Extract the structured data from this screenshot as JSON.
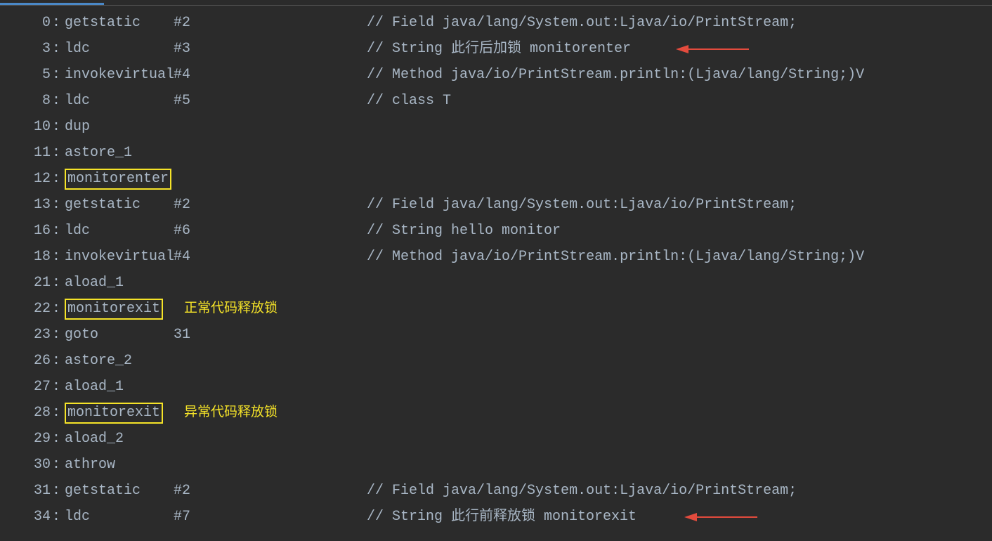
{
  "lines": [
    {
      "addr": "0",
      "instr": "getstatic",
      "arg": "#2",
      "comment": "// Field java/lang/System.out:Ljava/io/PrintStream;"
    },
    {
      "addr": "3",
      "instr": "ldc",
      "arg": "#3",
      "comment": "// String 此行后加锁 monitorenter",
      "arrow1": true
    },
    {
      "addr": "5",
      "instr": "invokevirtual",
      "arg": "#4",
      "comment": "// Method java/io/PrintStream.println:(Ljava/lang/String;)V"
    },
    {
      "addr": "8",
      "instr": "ldc",
      "arg": "#5",
      "comment": "// class T"
    },
    {
      "addr": "10",
      "instr": "dup",
      "arg": "",
      "comment": ""
    },
    {
      "addr": "11",
      "instr": "astore_1",
      "arg": "",
      "comment": ""
    },
    {
      "addr": "12",
      "instr": "monitorenter",
      "arg": "",
      "comment": "",
      "boxed": true
    },
    {
      "addr": "13",
      "instr": "getstatic",
      "arg": "#2",
      "comment": "// Field java/lang/System.out:Ljava/io/PrintStream;"
    },
    {
      "addr": "16",
      "instr": "ldc",
      "arg": "#6",
      "comment": "// String hello monitor"
    },
    {
      "addr": "18",
      "instr": "invokevirtual",
      "arg": "#4",
      "comment": "// Method java/io/PrintStream.println:(Ljava/lang/String;)V"
    },
    {
      "addr": "21",
      "instr": "aload_1",
      "arg": "",
      "comment": ""
    },
    {
      "addr": "22",
      "instr": "monitorexit",
      "arg": "",
      "comment": "",
      "boxed": true,
      "note": "正常代码释放锁"
    },
    {
      "addr": "23",
      "instr": "goto",
      "arg": "31",
      "comment": ""
    },
    {
      "addr": "26",
      "instr": "astore_2",
      "arg": "",
      "comment": ""
    },
    {
      "addr": "27",
      "instr": "aload_1",
      "arg": "",
      "comment": ""
    },
    {
      "addr": "28",
      "instr": "monitorexit",
      "arg": "",
      "comment": "",
      "boxed": true,
      "note": "异常代码释放锁"
    },
    {
      "addr": "29",
      "instr": "aload_2",
      "arg": "",
      "comment": ""
    },
    {
      "addr": "30",
      "instr": "athrow",
      "arg": "",
      "comment": ""
    },
    {
      "addr": "31",
      "instr": "getstatic",
      "arg": "#2",
      "comment": "// Field java/lang/System.out:Ljava/io/PrintStream;"
    },
    {
      "addr": "34",
      "instr": "ldc",
      "arg": "#7",
      "comment": "// String 此行前释放锁 monitorexit",
      "arrow2": true
    }
  ]
}
